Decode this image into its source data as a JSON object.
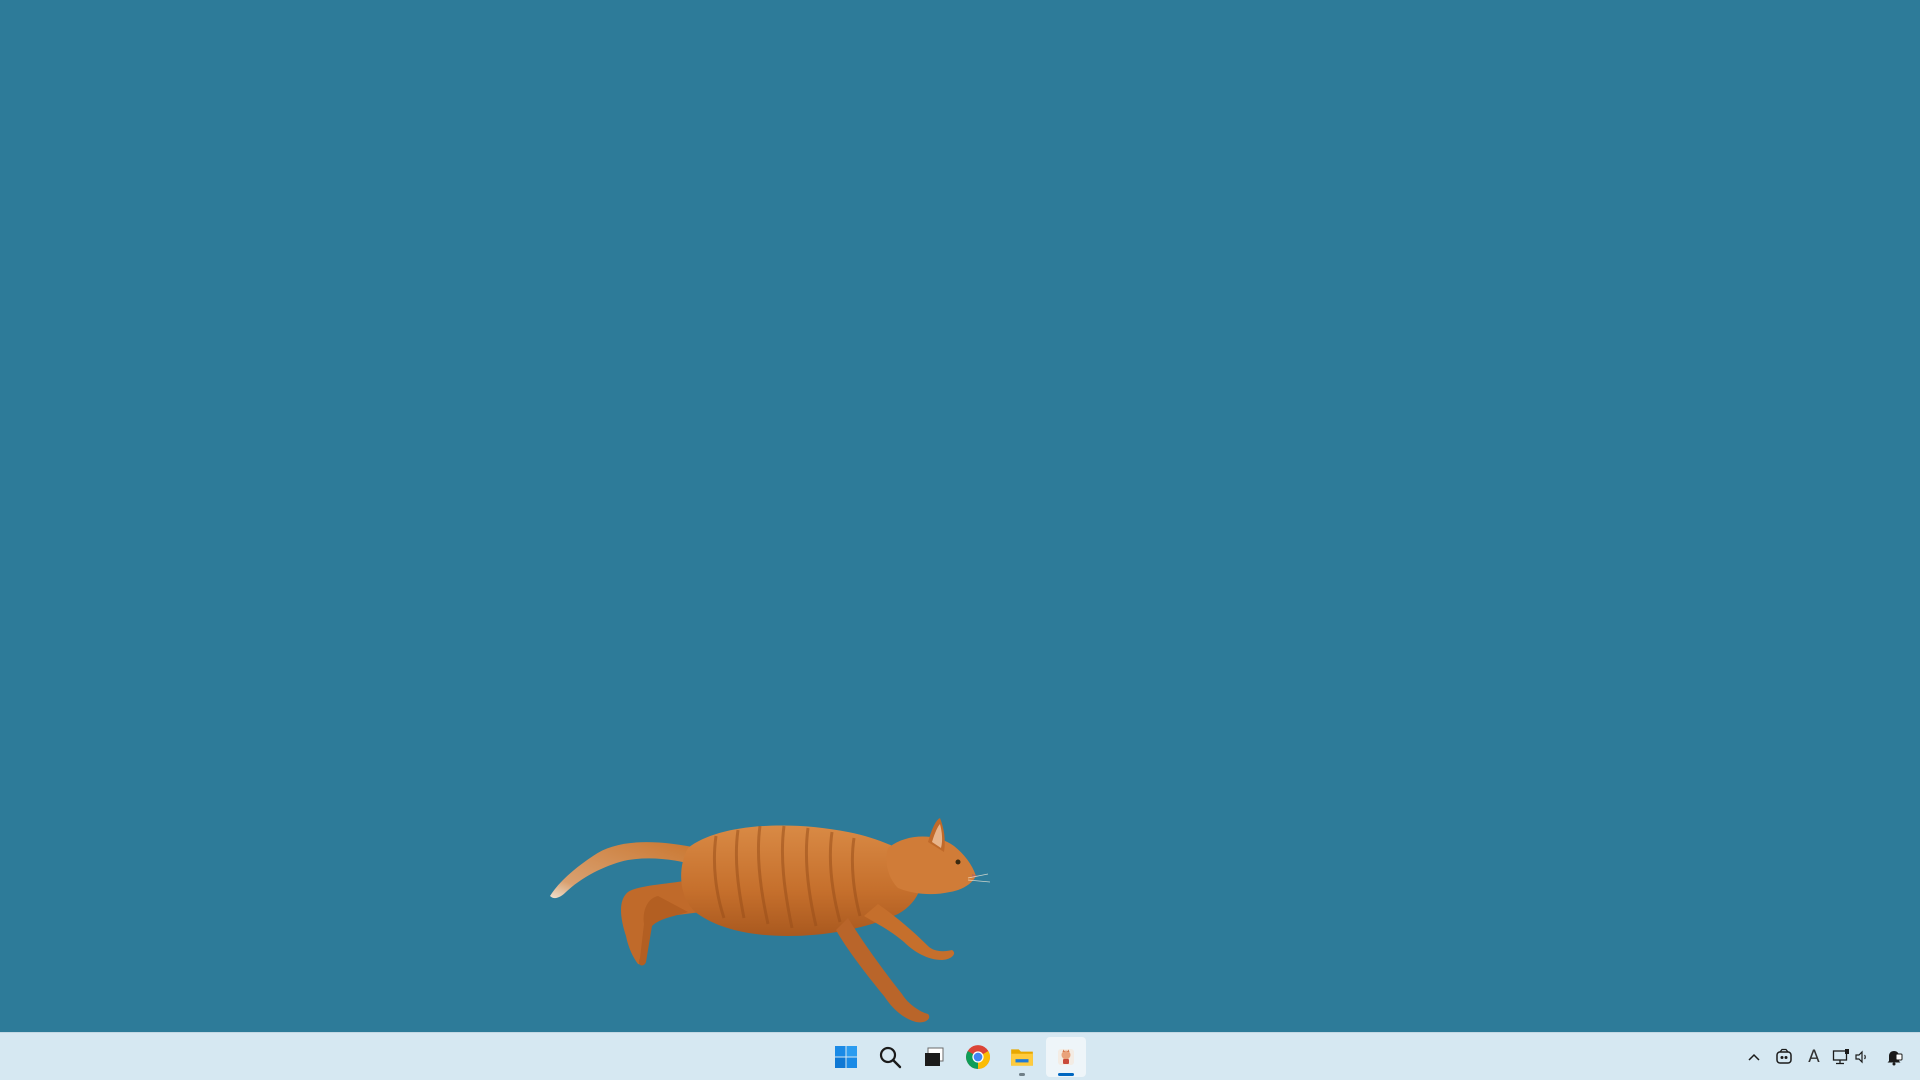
{
  "desktop": {
    "wallpaper_color": "#2d7b99",
    "pet": "running-cat-image"
  },
  "taskbar": {
    "background": "#d6e8f2",
    "pinned": [
      {
        "name": "start-icon",
        "running": false,
        "active": false
      },
      {
        "name": "search-icon",
        "running": false,
        "active": false
      },
      {
        "name": "task-view-icon",
        "running": false,
        "active": false
      },
      {
        "name": "chrome-icon",
        "running": false,
        "active": false
      },
      {
        "name": "file-explorer-icon",
        "running": true,
        "active": false
      },
      {
        "name": "desktop-pet-app-icon",
        "running": true,
        "active": true
      }
    ],
    "tray": {
      "overflow_icon": "chevron-up-icon",
      "input_indicator": "A",
      "icons": [
        "copilot-icon",
        "network-icon",
        "volume-icon",
        "notification-icon"
      ]
    }
  }
}
